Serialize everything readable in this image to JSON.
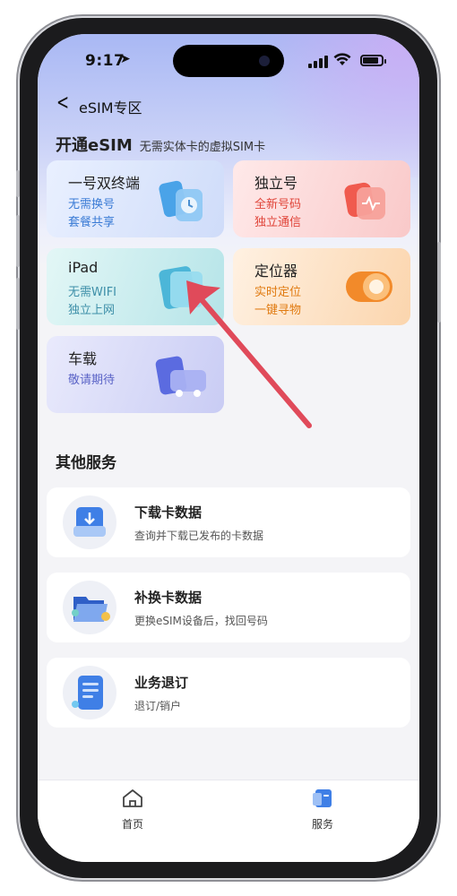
{
  "status_bar": {
    "time": "9:17"
  },
  "nav": {
    "title": "eSIM专区"
  },
  "open_section": {
    "title": "开通eSIM",
    "subtitle": "无需实体卡的虚拟SIM卡"
  },
  "cards": [
    {
      "title": "一号双终端",
      "line1": "无需换号",
      "line2": "套餐共享",
      "accent": "#3a7bd5"
    },
    {
      "title": "独立号",
      "line1": "全新号码",
      "line2": "独立通信",
      "accent": "#e0453a"
    },
    {
      "title": "iPad",
      "line1": "无需WIFI",
      "line2": "独立上网",
      "accent": "#3d8fa8"
    },
    {
      "title": "定位器",
      "line1": "实时定位",
      "line2": "一键寻物",
      "accent": "#e07a10"
    },
    {
      "title": "车载",
      "line1": "敬请期待",
      "line2": "",
      "accent": "#5b64c7"
    }
  ],
  "other_services": {
    "title": "其他服务",
    "items": [
      {
        "title": "下载卡数据",
        "subtitle": "查询并下载已发布的卡数据"
      },
      {
        "title": "补换卡数据",
        "subtitle": "更换eSIM设备后，找回号码"
      },
      {
        "title": "业务退订",
        "subtitle": "退订/销户"
      }
    ]
  },
  "tabbar": {
    "home": "首页",
    "services": "服务"
  },
  "annotation": {
    "arrow_color": "#e04a5a"
  }
}
